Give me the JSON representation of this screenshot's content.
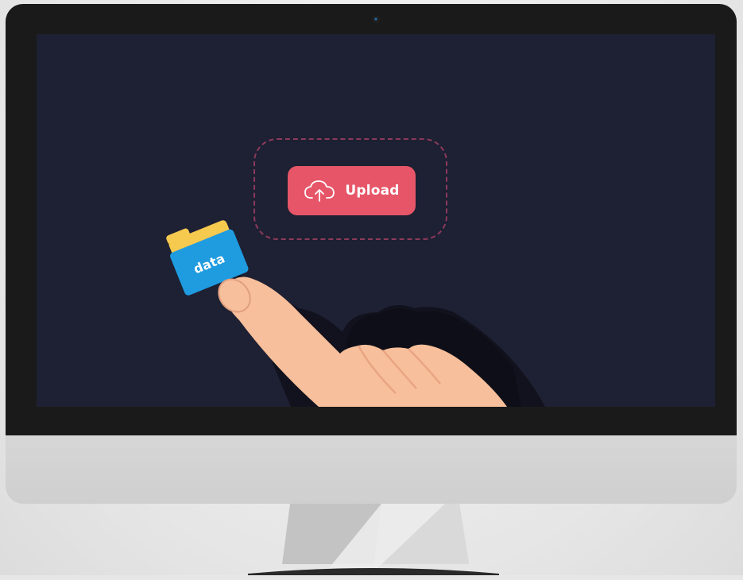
{
  "screen": {
    "upload_button": {
      "label": "Upload",
      "color": "#e65668",
      "icon": "cloud-upload-icon"
    },
    "drop_zone": {
      "border_color": "#8b3a5c"
    },
    "folder": {
      "label": "data",
      "front_color": "#1f9be0",
      "back_color": "#f6c94f"
    }
  },
  "colors": {
    "screen_bg": "#1e2033",
    "bezel": "#1a1a1a",
    "chin": "#d2d2d2",
    "skin": "#f7bf9b"
  }
}
